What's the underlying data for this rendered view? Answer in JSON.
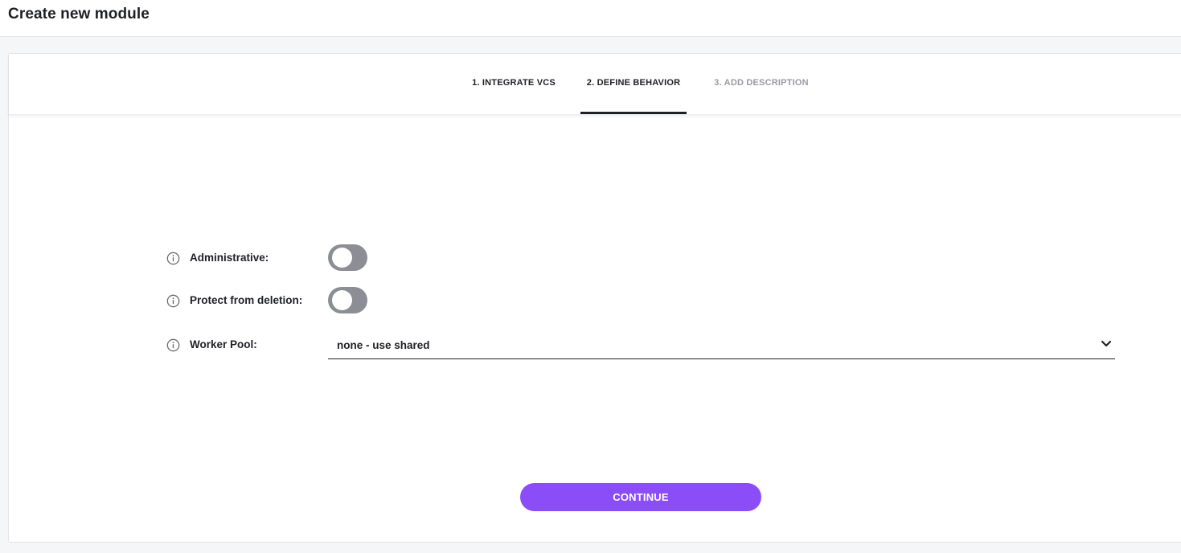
{
  "header": {
    "title": "Create new module"
  },
  "stepper": {
    "steps": [
      {
        "label": "1. INTEGRATE VCS",
        "state": "done"
      },
      {
        "label": "2. DEFINE BEHAVIOR",
        "state": "active"
      },
      {
        "label": "3. ADD DESCRIPTION",
        "state": "pending"
      }
    ]
  },
  "form": {
    "administrative": {
      "label": "Administrative:",
      "icon": "info-icon",
      "enabled": false
    },
    "protect": {
      "label": "Protect from deletion:",
      "icon": "info-icon",
      "enabled": false
    },
    "worker_pool": {
      "label": "Worker Pool:",
      "icon": "info-icon",
      "value": "none - use shared",
      "dropdown_icon": "chevron-down-icon"
    }
  },
  "actions": {
    "continue_label": "CONTINUE"
  },
  "colors": {
    "accent": "#8b4df7",
    "toggle_off": "#8c8e96",
    "text": "#1f2024",
    "muted": "#9a9ba1"
  }
}
